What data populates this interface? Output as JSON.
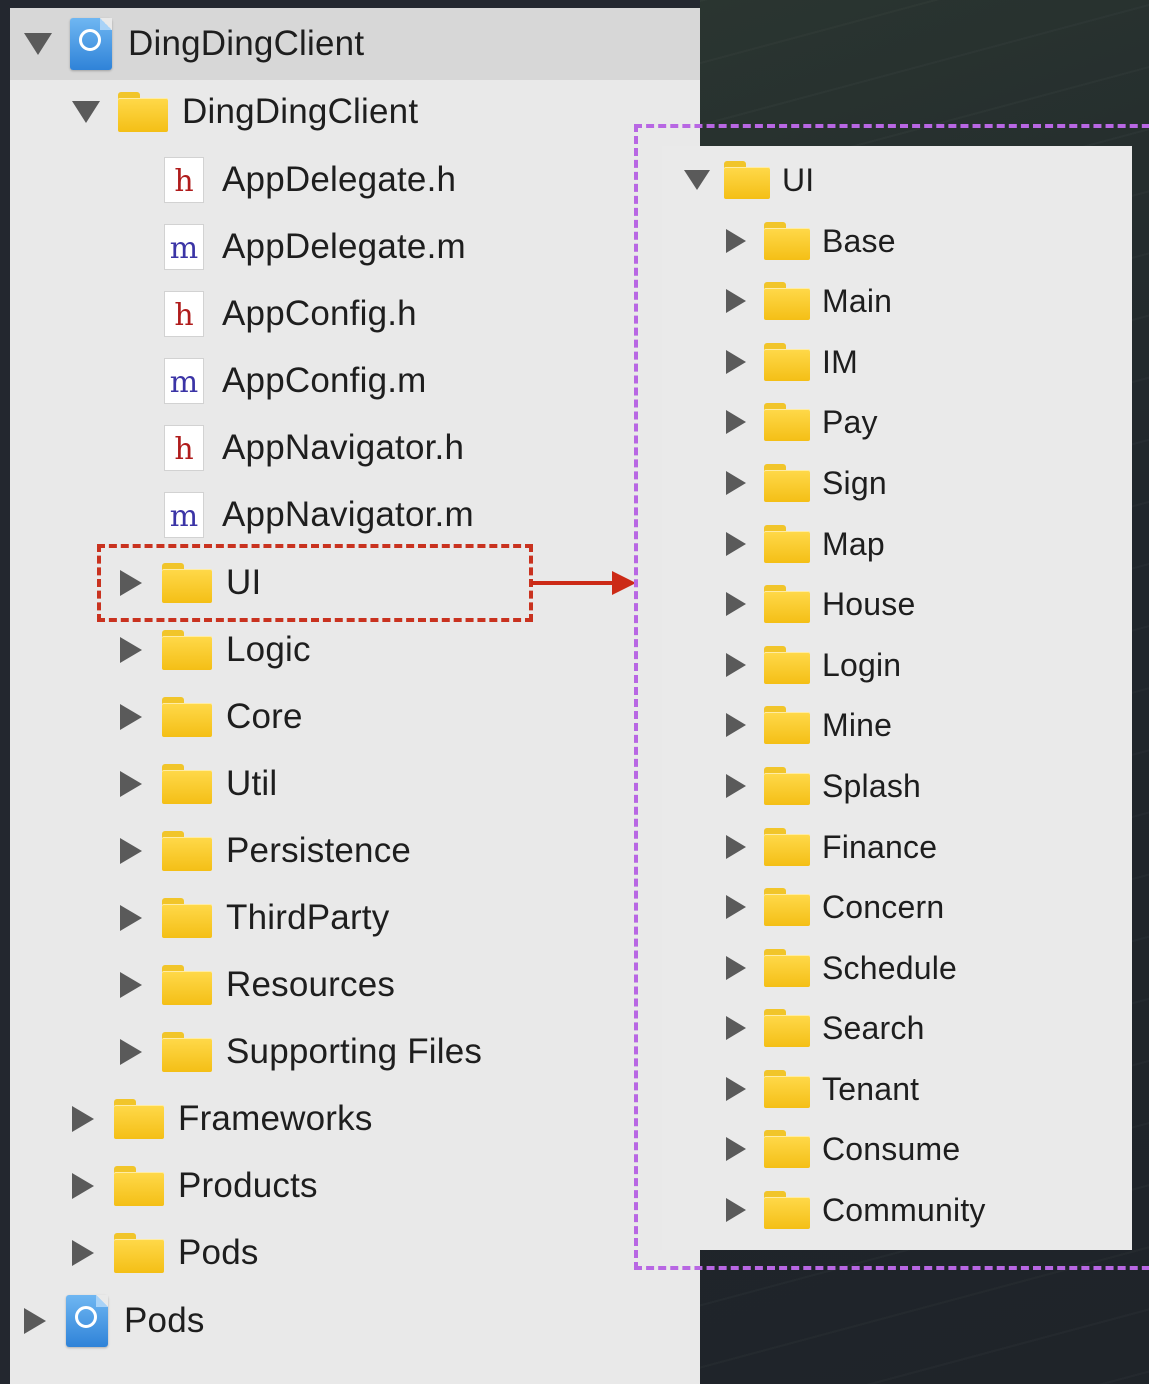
{
  "navigator": {
    "project": {
      "label": "DingDingClient",
      "icon": "xcode-project-icon"
    },
    "group": {
      "label": "DingDingClient",
      "icon": "folder-icon"
    },
    "files": [
      {
        "label": "AppDelegate.h",
        "glyph": "h"
      },
      {
        "label": "AppDelegate.m",
        "glyph": "m"
      },
      {
        "label": "AppConfig.h",
        "glyph": "h"
      },
      {
        "label": "AppConfig.m",
        "glyph": "m"
      },
      {
        "label": "AppNavigator.h",
        "glyph": "h"
      },
      {
        "label": "AppNavigator.m",
        "glyph": "m"
      }
    ],
    "subfolders": [
      {
        "label": "UI"
      },
      {
        "label": "Logic"
      },
      {
        "label": "Core"
      },
      {
        "label": "Util"
      },
      {
        "label": "Persistence"
      },
      {
        "label": "ThirdParty"
      },
      {
        "label": "Resources"
      },
      {
        "label": "Supporting Files"
      }
    ],
    "top_folders": [
      {
        "label": "Frameworks"
      },
      {
        "label": "Products"
      },
      {
        "label": "Pods"
      }
    ],
    "pods_project": {
      "label": "Pods",
      "icon": "xcode-project-icon"
    }
  },
  "ui_expanded": {
    "root": {
      "label": "UI"
    },
    "folders": [
      {
        "label": "Base"
      },
      {
        "label": "Main"
      },
      {
        "label": "IM"
      },
      {
        "label": "Pay"
      },
      {
        "label": "Sign"
      },
      {
        "label": "Map"
      },
      {
        "label": "House"
      },
      {
        "label": "Login"
      },
      {
        "label": "Mine"
      },
      {
        "label": "Splash"
      },
      {
        "label": "Finance"
      },
      {
        "label": "Concern"
      },
      {
        "label": "Schedule"
      },
      {
        "label": "Search"
      },
      {
        "label": "Tenant"
      },
      {
        "label": "Consume"
      },
      {
        "label": "Community"
      }
    ]
  },
  "colors": {
    "highlight_box": "#c9321f",
    "expanded_box": "#b867e3",
    "folder": "#f4bf16",
    "header_file": "#b01c1c",
    "impl_file": "#3b34a6"
  }
}
